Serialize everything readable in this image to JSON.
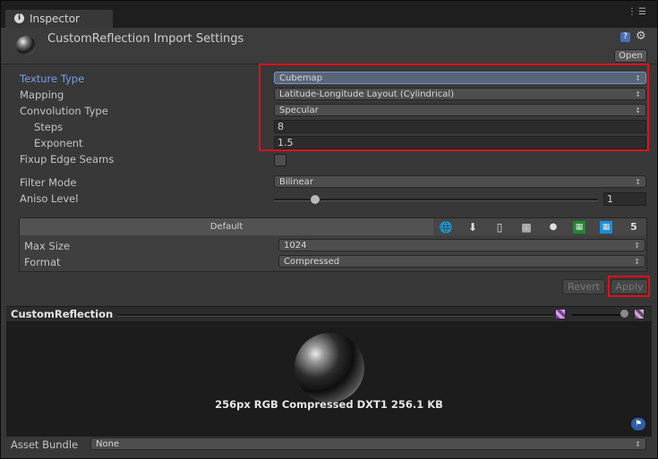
{
  "tab": {
    "title": "Inspector"
  },
  "header": {
    "title": "CustomReflection Import Settings",
    "open_label": "Open"
  },
  "settings": {
    "texture_type": {
      "label": "Texture Type",
      "value": "Cubemap"
    },
    "mapping": {
      "label": "Mapping",
      "value": "Latitude-Longitude Layout (Cylindrical)"
    },
    "convolution_type": {
      "label": "Convolution Type",
      "value": "Specular"
    },
    "steps": {
      "label": "Steps",
      "value": "8"
    },
    "exponent": {
      "label": "Exponent",
      "value": "1.5"
    },
    "fixup_edge_seams": {
      "label": "Fixup Edge Seams",
      "checked": false
    },
    "filter_mode": {
      "label": "Filter Mode",
      "value": "Bilinear"
    },
    "aniso_level": {
      "label": "Aniso Level",
      "value": "1",
      "min": 0,
      "max": 9,
      "level": 1
    }
  },
  "platform": {
    "default_label": "Default",
    "icons": [
      "globe-icon",
      "download-icon",
      "phone-icon",
      "android-icon",
      "blackberry-icon",
      "windows-store-icon",
      "windows-phone-icon",
      "html5-icon"
    ],
    "max_size": {
      "label": "Max Size",
      "value": "1024"
    },
    "format": {
      "label": "Format",
      "value": "Compressed"
    }
  },
  "actions": {
    "revert_label": "Revert",
    "apply_label": "Apply"
  },
  "preview": {
    "title": "CustomReflection",
    "info": "256px RGB Compressed DXT1 256.1 KB"
  },
  "asset_bundle": {
    "label": "Asset Bundle",
    "value": "None"
  },
  "colors": {
    "highlight": "#e0101a",
    "active_label": "#7a9ee8",
    "panel_bg": "#383838"
  }
}
